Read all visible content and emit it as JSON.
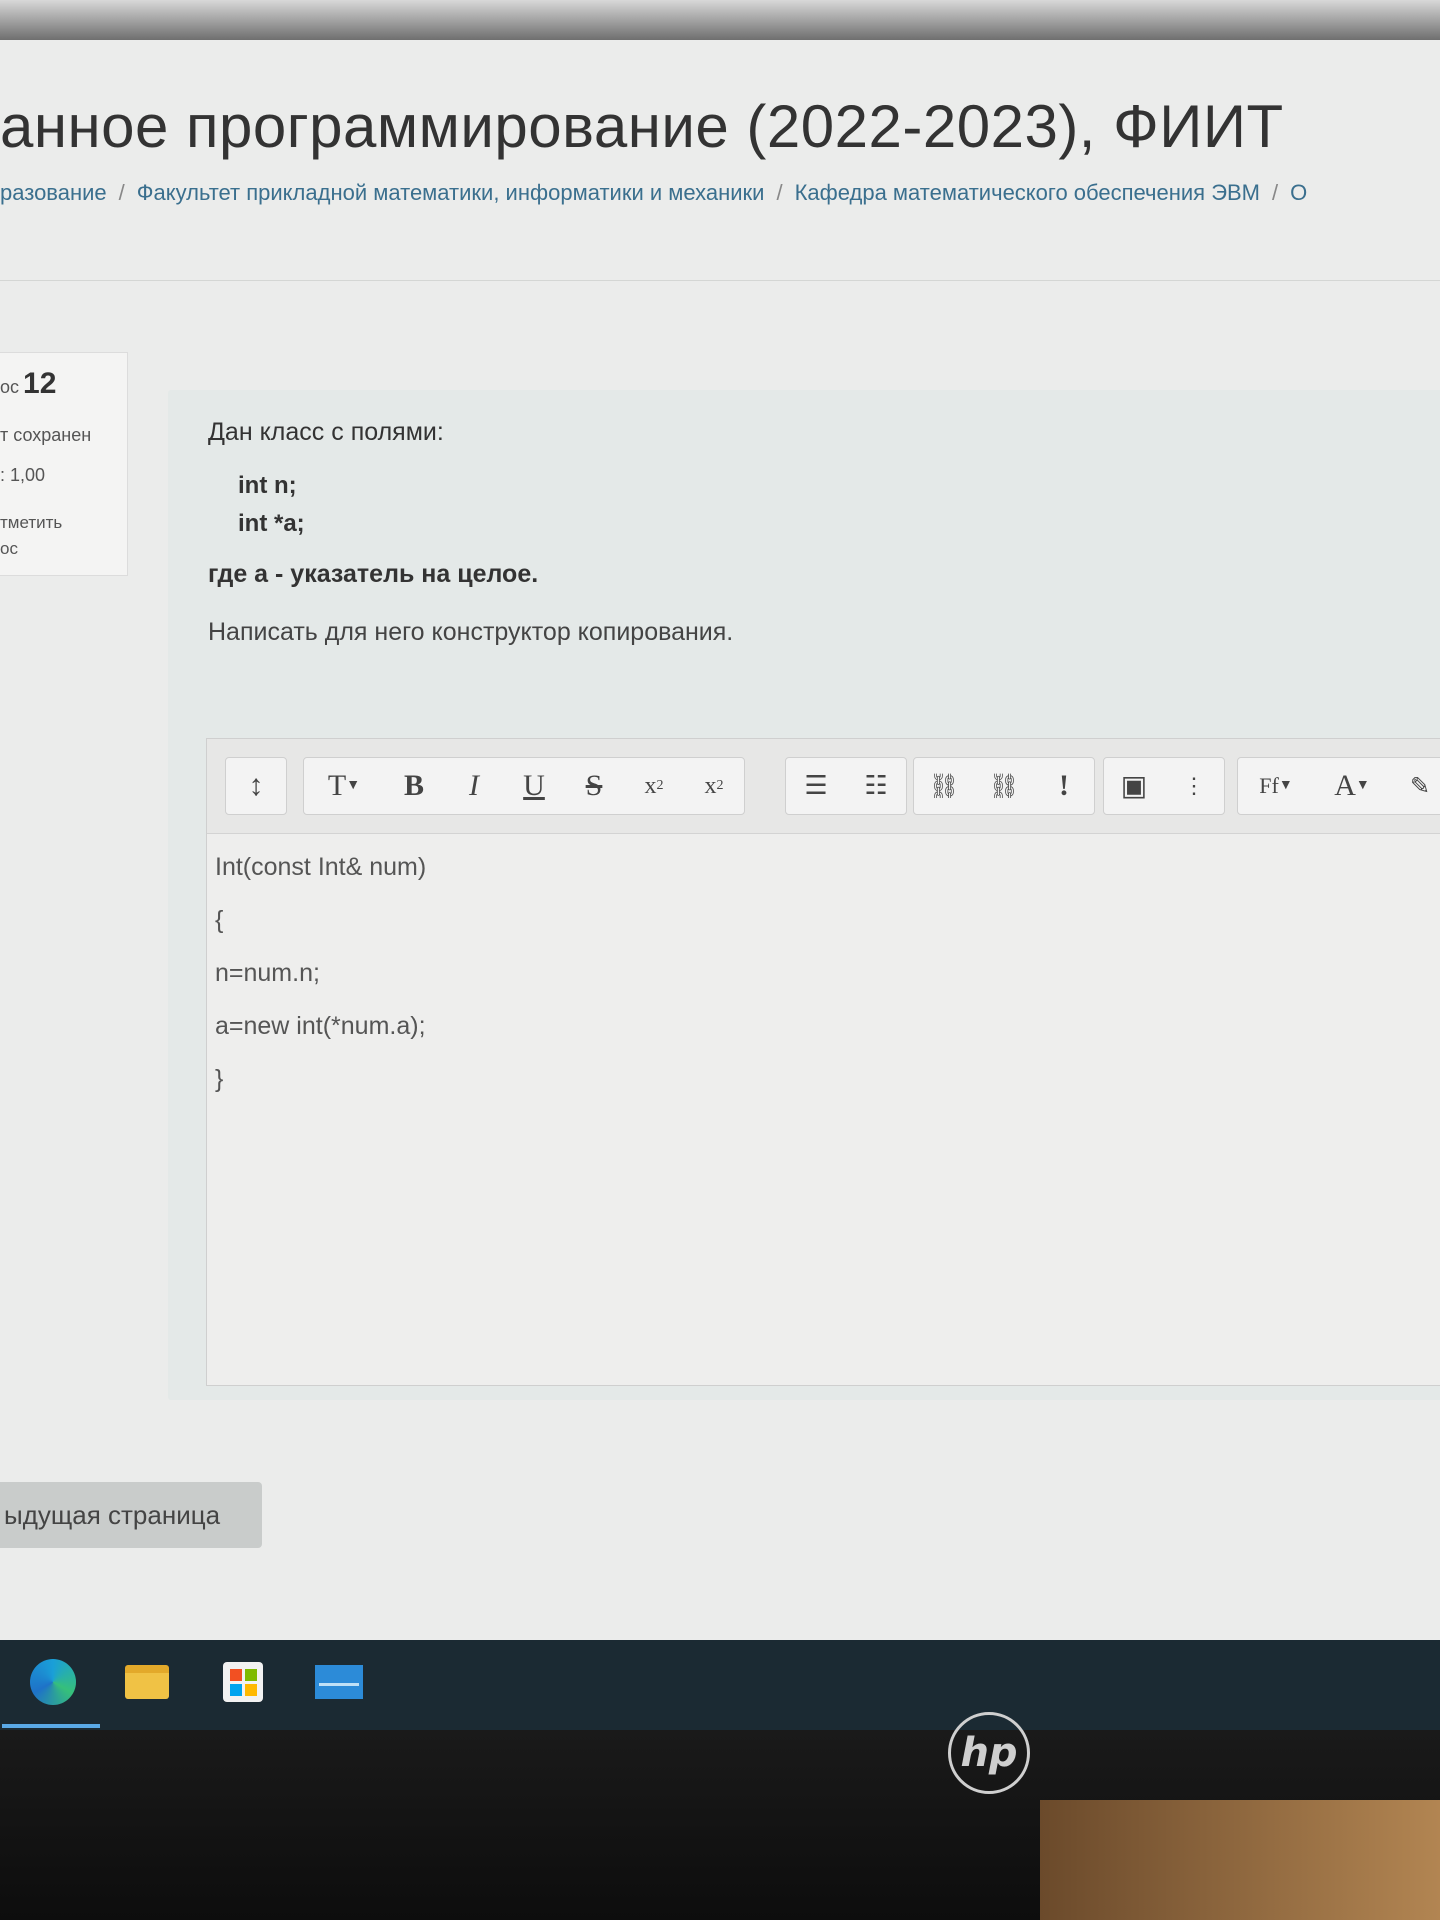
{
  "header": {
    "title": "анное программирование (2022-2023), ФИИТ",
    "breadcrumb": [
      "разование",
      "Факультет прикладной математики, информатики и механики",
      "Кафедра математического обеспечения ЭВМ",
      "О"
    ]
  },
  "question_info": {
    "number_label": "ос",
    "number": "12",
    "status": "т сохранен",
    "mark": ": 1,00",
    "flag_line1": "тметить",
    "flag_line2": "ос"
  },
  "question": {
    "intro": "Дан класс с полями:",
    "code_lines": [
      "int n;",
      "int *a;"
    ],
    "note": "где a - указатель на целое.",
    "instruction": "Написать для него конструктор копирования."
  },
  "editor": {
    "toolbar": {
      "collapse": "↕",
      "paragraph": "T",
      "bold": "B",
      "italic": "I",
      "underline": "U",
      "strike": "S",
      "subscript": "x",
      "subscript_mark": "2",
      "superscript": "x",
      "superscript_mark": "2",
      "unordered_list": "☰",
      "ordered_list": "☷",
      "link": "⛓",
      "unlink": "⛓",
      "special": "!",
      "image": "▣",
      "more": "⋮",
      "font": "Ff",
      "font_color": "A",
      "brush": "✎"
    },
    "content": [
      "Int(const Int& num)",
      "{",
      "n=num.n;",
      "a=new int(*num.a);",
      "}"
    ]
  },
  "navigation": {
    "prev_page": "ыдущая страница"
  },
  "taskbar": {
    "icons": [
      "edge-icon",
      "folder-icon",
      "store-icon",
      "mail-icon"
    ]
  },
  "monitor": {
    "brand": "hp"
  }
}
